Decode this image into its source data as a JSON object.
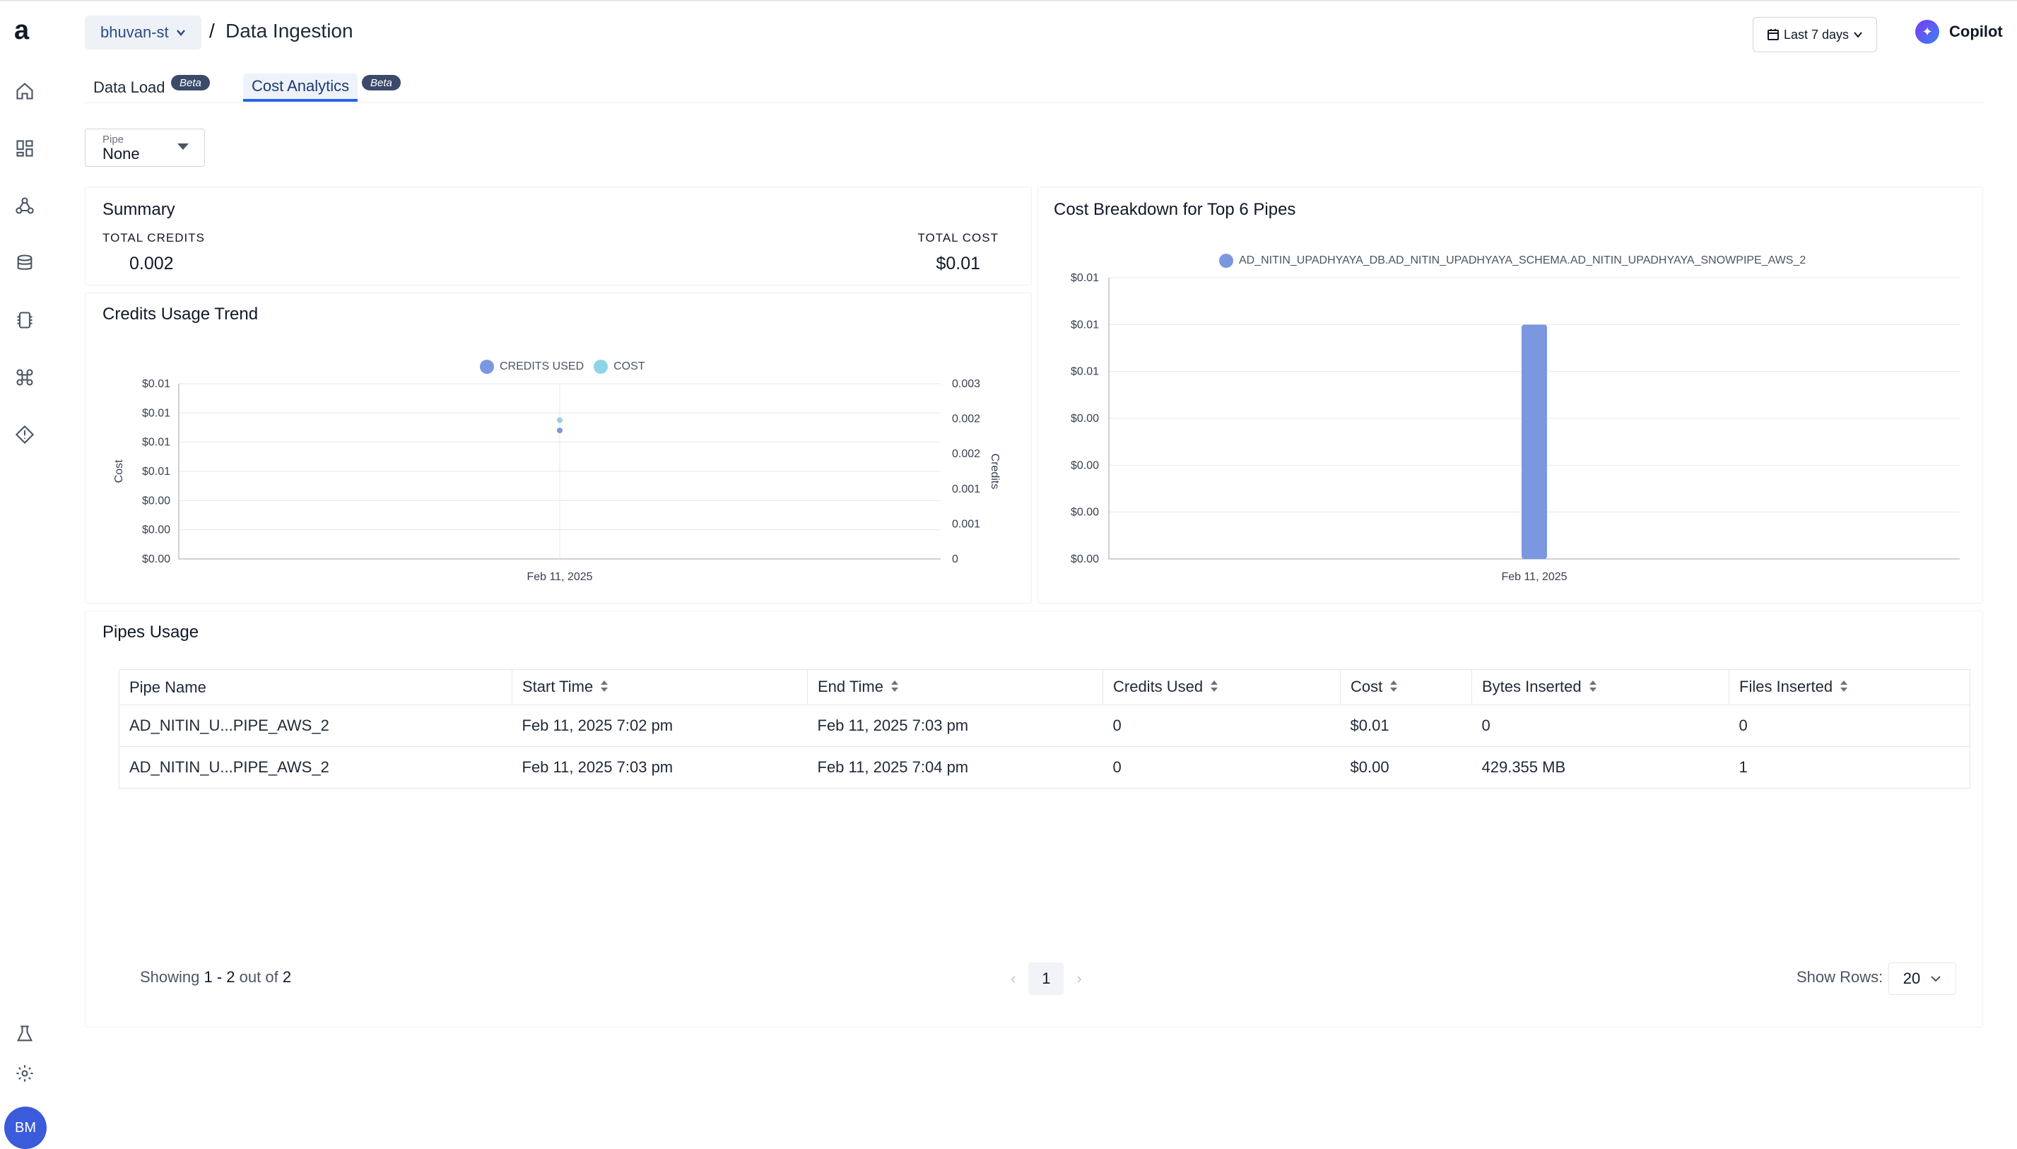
{
  "sidebar": {
    "logo": "a",
    "icons": [
      "home-icon",
      "dashboard-icon",
      "workflow-icon",
      "database-icon",
      "chip-icon",
      "command-icon",
      "diamond-alert-icon",
      "lab-flask-icon",
      "settings-icon"
    ],
    "avatar_initials": "BM"
  },
  "header": {
    "org": "bhuvan-st",
    "separator": "/",
    "title": "Data Ingestion",
    "date_range": "Last 7 days",
    "copilot": "Copilot"
  },
  "tabs": [
    {
      "label": "Data Load",
      "badge": "Beta",
      "active": false
    },
    {
      "label": "Cost Analytics",
      "badge": "Beta",
      "active": true
    }
  ],
  "filter": {
    "label": "Pipe",
    "value": "None"
  },
  "summary": {
    "title": "Summary",
    "total_credits_label": "TOTAL CREDITS",
    "total_credits_value": "0.002",
    "total_cost_label": "TOTAL COST",
    "total_cost_value": "$0.01"
  },
  "chart_data": [
    {
      "type": "scatter",
      "title": "Credits Usage Trend",
      "x": [
        "Feb 11, 2025"
      ],
      "series": [
        {
          "name": "CREDITS USED",
          "values": [
            0.0022
          ],
          "axis": "right",
          "color": "#7b97e0"
        },
        {
          "name": "COST",
          "values": [
            0.0095
          ],
          "axis": "left",
          "color": "#8fd3e8"
        }
      ],
      "ylabel": "Cost",
      "y2label": "Credits",
      "yticks": [
        "$0.00",
        "$0.00",
        "$0.00",
        "$0.01",
        "$0.01",
        "$0.01",
        "$0.01"
      ],
      "y2ticks": [
        "0",
        "0.001",
        "0.001",
        "0.002",
        "0.002",
        "0.003"
      ],
      "grid": true,
      "legend": "top-center"
    },
    {
      "type": "bar",
      "title": "Cost Breakdown for Top 6 Pipes",
      "categories": [
        "Feb 11, 2025"
      ],
      "series": [
        {
          "name": "AD_NITIN_UPADHYAYA_DB.AD_NITIN_UPADHYAYA_SCHEMA.AD_NITIN_UPADHYAYA_SNOWPIPE_AWS_2",
          "values": [
            0.01
          ],
          "color": "#7b97e0"
        }
      ],
      "yticks": [
        "$0.00",
        "$0.00",
        "$0.00",
        "$0.00",
        "$0.01",
        "$0.01",
        "$0.01"
      ],
      "ylim": [
        0,
        0.012
      ],
      "grid": true,
      "legend": "top-center"
    }
  ],
  "pipes_usage": {
    "title": "Pipes Usage",
    "columns": [
      "Pipe Name",
      "Start Time",
      "End Time",
      "Credits Used",
      "Cost",
      "Bytes Inserted",
      "Files Inserted"
    ],
    "rows": [
      [
        "AD_NITIN_U...PIPE_AWS_2",
        "Feb 11, 2025 7:02 pm",
        "Feb 11, 2025 7:03 pm",
        "0",
        "$0.01",
        "0",
        "0"
      ],
      [
        "AD_NITIN_U...PIPE_AWS_2",
        "Feb 11, 2025 7:03 pm",
        "Feb 11, 2025 7:04 pm",
        "0",
        "$0.00",
        "429.355 MB",
        "1"
      ]
    ],
    "showing_prefix": "Showing",
    "showing_range": "1 - 2",
    "showing_mid": "out of",
    "showing_total": "2",
    "page": "1",
    "rows_label": "Show Rows:",
    "rows_value": "20"
  }
}
